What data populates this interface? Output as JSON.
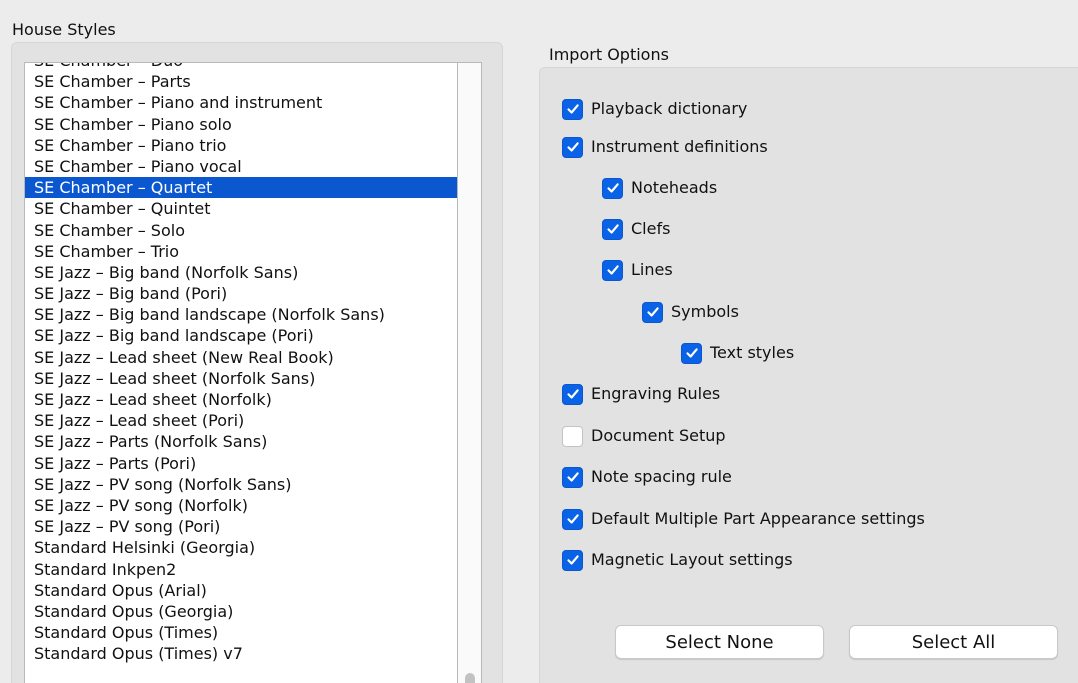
{
  "house_styles": {
    "title": "House Styles",
    "selected_index": 6,
    "items": [
      "SE Chamber – Duo",
      "SE Chamber – Parts",
      "SE Chamber – Piano and instrument",
      "SE Chamber – Piano solo",
      "SE Chamber – Piano trio",
      "SE Chamber – Piano vocal",
      "SE Chamber – Quartet",
      "SE Chamber – Quintet",
      "SE Chamber – Solo",
      "SE Chamber – Trio",
      "SE Jazz – Big band (Norfolk Sans)",
      "SE Jazz – Big band (Pori)",
      "SE Jazz – Big band landscape (Norfolk Sans)",
      "SE Jazz – Big band landscape (Pori)",
      "SE Jazz – Lead sheet (New Real Book)",
      "SE Jazz – Lead sheet (Norfolk Sans)",
      "SE Jazz – Lead sheet (Norfolk)",
      "SE Jazz – Lead sheet (Pori)",
      "SE Jazz – Parts (Norfolk Sans)",
      "SE Jazz – Parts (Pori)",
      "SE Jazz – PV song (Norfolk Sans)",
      "SE Jazz – PV song (Norfolk)",
      "SE Jazz – PV song (Pori)",
      "Standard Helsinki (Georgia)",
      "Standard Inkpen2",
      "Standard Opus (Arial)",
      "Standard Opus (Georgia)",
      "Standard Opus (Times)",
      "Standard Opus (Times) v7"
    ]
  },
  "import_options": {
    "title": "Import Options",
    "options": [
      {
        "label": "Playback dictionary",
        "checked": true,
        "indent": 0
      },
      {
        "label": "Instrument definitions",
        "checked": true,
        "indent": 0
      },
      {
        "label": "Noteheads",
        "checked": true,
        "indent": 1
      },
      {
        "label": "Clefs",
        "checked": true,
        "indent": 1
      },
      {
        "label": "Lines",
        "checked": true,
        "indent": 1
      },
      {
        "label": "Symbols",
        "checked": true,
        "indent": 2
      },
      {
        "label": "Text styles",
        "checked": true,
        "indent": 3
      },
      {
        "label": "Engraving Rules",
        "checked": true,
        "indent": 0
      },
      {
        "label": "Document Setup",
        "checked": false,
        "indent": 0
      },
      {
        "label": "Note spacing rule",
        "checked": true,
        "indent": 0
      },
      {
        "label": "Default Multiple Part Appearance settings",
        "checked": true,
        "indent": 0
      },
      {
        "label": "Magnetic Layout settings",
        "checked": true,
        "indent": 0
      }
    ],
    "select_none_label": "Select None",
    "select_all_label": "Select All"
  },
  "colors": {
    "selection": "#0a57d0",
    "checkbox_checked": "#0a62e6",
    "background": "#ececec"
  }
}
